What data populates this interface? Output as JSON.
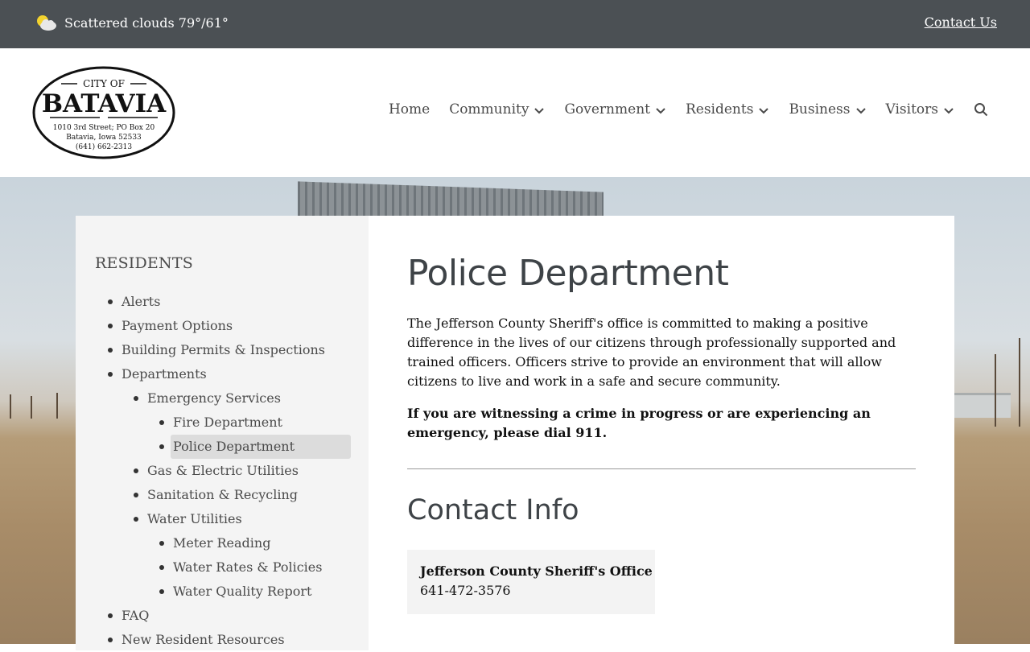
{
  "topbar": {
    "weather_text": "Scattered clouds 79°/61°",
    "contact_label": "Contact Us"
  },
  "logo": {
    "city_of": "CITY OF",
    "name": "BATAVIA",
    "address1": "1010 3rd Street; PO Box 20",
    "address2": "Batavia, Iowa 52533",
    "phone": "(641) 662-2313"
  },
  "nav": {
    "items": [
      {
        "label": "Home",
        "has_dropdown": false
      },
      {
        "label": "Community",
        "has_dropdown": true
      },
      {
        "label": "Government",
        "has_dropdown": true
      },
      {
        "label": "Residents",
        "has_dropdown": true
      },
      {
        "label": "Business",
        "has_dropdown": true
      },
      {
        "label": "Visitors",
        "has_dropdown": true
      }
    ],
    "search_icon": "search-icon"
  },
  "sidebar": {
    "title": "RESIDENTS",
    "items": [
      {
        "label": "Alerts",
        "level": 0
      },
      {
        "label": "Payment Options",
        "level": 0
      },
      {
        "label": "Building Permits & Inspections",
        "level": 0
      },
      {
        "label": "Departments",
        "level": 0
      },
      {
        "label": "Emergency Services",
        "level": 1
      },
      {
        "label": "Fire Department",
        "level": 2
      },
      {
        "label": "Police Department",
        "level": 2,
        "active": true
      },
      {
        "label": "Gas & Electric Utilities",
        "level": 1
      },
      {
        "label": "Sanitation & Recycling",
        "level": 1
      },
      {
        "label": "Water Utilities",
        "level": 1
      },
      {
        "label": "Meter Reading",
        "level": 2
      },
      {
        "label": "Water Rates & Policies",
        "level": 2
      },
      {
        "label": "Water Quality Report",
        "level": 2
      },
      {
        "label": "FAQ",
        "level": 0
      },
      {
        "label": "New Resident Resources",
        "level": 0
      }
    ]
  },
  "main": {
    "title": "Police Department",
    "paragraph": "The Jefferson County Sheriff's office is committed to making a positive difference in the lives of our citizens through professionally supported and trained officers. Officers strive to provide an environment that will allow citizens to live and work in a safe and secure community.",
    "emergency": "If you are witnessing a crime in progress or are experiencing an emergency, please dial 911.",
    "contact_title": "Contact Info",
    "contact_card": {
      "name": "Jefferson County Sheriff's Office",
      "phone": "641-472-3576"
    }
  },
  "colors": {
    "topbar_bg": "#4b5054",
    "sidebar_bg": "#f4f4f4",
    "active_item_bg": "#dcdcdc",
    "heading": "#3e4347"
  }
}
